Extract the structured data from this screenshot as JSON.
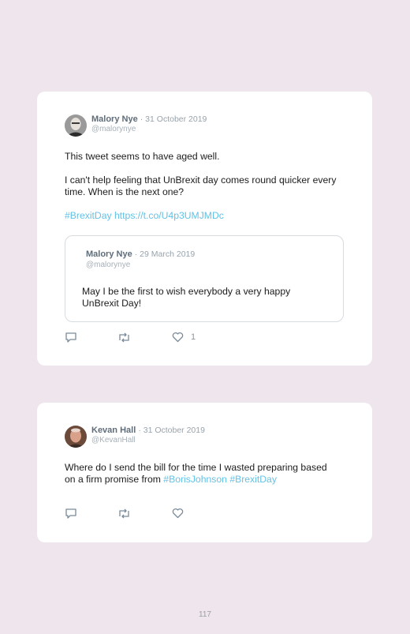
{
  "tweets": [
    {
      "author": "Malory Nye",
      "date": "· 31 October 2019",
      "handle": "@malorynye",
      "line1": "This tweet seems to have aged well.",
      "line2": "I can't help feeling that UnBrexit day comes round quicker every time. When is the next one?",
      "hashtag": "#BrexitDay",
      "link": "https://t.co/U4p3UMJMDc",
      "quoted": {
        "author": "Malory Nye",
        "date": "· 29 March 2019",
        "handle": "@malorynye",
        "text": "May I be the first to wish everybody a very happy UnBrexit Day!"
      },
      "like_count": "1"
    },
    {
      "author": "Kevan Hall",
      "date": "· 31 October 2019",
      "handle": "@KevanHall",
      "text": "Where do I send the bill for the time I wasted preparing based on a firm promise from ",
      "hashtag1": "#BorisJohnson",
      "hashtag2": "#BrexitDay"
    }
  ],
  "icons": {
    "reply": "reply-icon",
    "retweet": "retweet-icon",
    "like": "heart-icon"
  },
  "colors": {
    "background": "#efe6ed",
    "card": "#ffffff",
    "link": "#63c2e6",
    "name": "#5f6d7a"
  },
  "page_number": "117"
}
